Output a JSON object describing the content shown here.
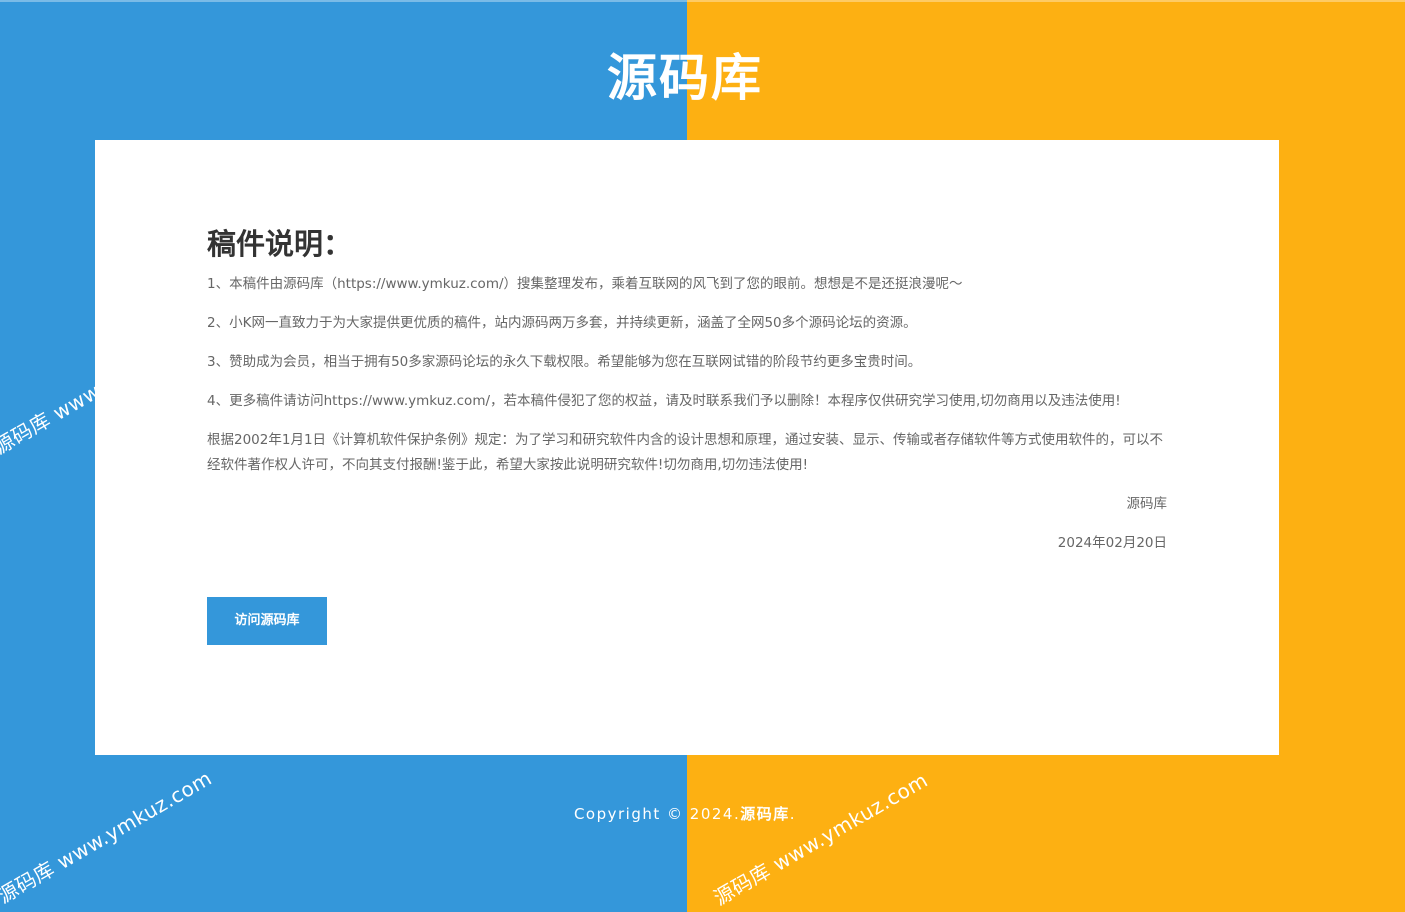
{
  "header": {
    "site_title": "源码库"
  },
  "notice": {
    "heading": "稿件说明：",
    "paragraphs": [
      "1、本稿件由源码库（https://www.ymkuz.com/）搜集整理发布，乘着互联网的风飞到了您的眼前。想想是不是还挺浪漫呢～",
      "2、小K网一直致力于为大家提供更优质的稿件，站内源码两万多套，并持续更新，涵盖了全网50多个源码论坛的资源。",
      "3、赞助成为会员，相当于拥有50多家源码论坛的永久下载权限。希望能够为您在互联网试错的阶段节约更多宝贵时间。",
      "4、更多稿件请访问https://www.ymkuz.com/，若本稿件侵犯了您的权益，请及时联系我们予以删除！本程序仅供研究学习使用,切勿商用以及违法使用!",
      "根据2002年1月1日《计算机软件保护条例》规定：为了学习和研究软件内含的设计思想和原理，通过安装、显示、传输或者存储软件等方式使用软件的，可以不经软件著作权人许可，不向其支付报酬!鉴于此，希望大家按此说明研究软件!切勿商用,切勿违法使用!"
    ],
    "signature": "源码库",
    "date": "2024年02月20日",
    "visit_button": "访问源码库"
  },
  "footer": {
    "copyright_prefix": "Copyright © 2024.",
    "brand": "源码库",
    "suffix": "."
  },
  "watermark": {
    "text": "源码库 www.ymkuz.com"
  },
  "colors": {
    "left_panel": "#3497da",
    "right_panel": "#fdb012",
    "button": "#3497da",
    "card": "#ffffff"
  }
}
